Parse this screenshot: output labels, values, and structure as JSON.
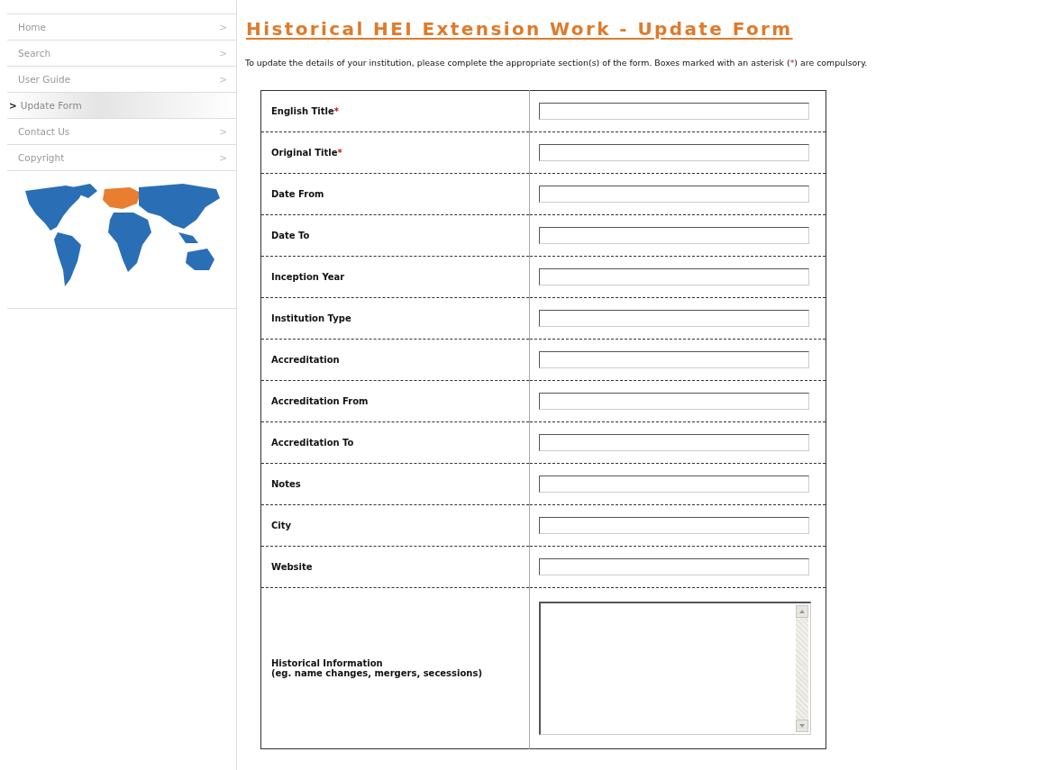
{
  "sidebar": {
    "items": [
      {
        "label": "Home",
        "chevron": ">",
        "selected": false
      },
      {
        "label": "Search",
        "chevron": ">",
        "selected": false
      },
      {
        "label": "User Guide",
        "chevron": ">",
        "selected": false
      },
      {
        "label": "Update Form",
        "chevron": ">",
        "selected": true
      },
      {
        "label": "Contact Us",
        "chevron": ">",
        "selected": false
      },
      {
        "label": "Copyright",
        "chevron": ">",
        "selected": false
      }
    ]
  },
  "title": "Historical HEI Extension Work - Update Form",
  "intro": {
    "before": "To update the details of your institution, please complete the appropriate section(s) of the form. Boxes marked with an asterisk (",
    "mark": "*",
    "after": ") are compulsory."
  },
  "form": {
    "fields": [
      {
        "label": "English Title",
        "mark": "*",
        "kind": "input"
      },
      {
        "label": "Original Title",
        "mark": "*",
        "kind": "input"
      },
      {
        "label": "Date From",
        "kind": "input"
      },
      {
        "label": "Date To",
        "kind": "input"
      },
      {
        "label": "Inception Year",
        "kind": "input"
      },
      {
        "label": "Institution Type",
        "kind": "input"
      },
      {
        "label": "Accreditation",
        "kind": "input"
      },
      {
        "label": "Accreditation From",
        "kind": "input"
      },
      {
        "label": "Accreditation To",
        "kind": "input"
      },
      {
        "label": "Notes",
        "kind": "input"
      },
      {
        "label": "City",
        "kind": "input"
      },
      {
        "label": "Website",
        "kind": "input"
      },
      {
        "label": "Historical Information",
        "hint": "(eg. name changes, mergers, secessions)",
        "kind": "textarea"
      }
    ]
  }
}
